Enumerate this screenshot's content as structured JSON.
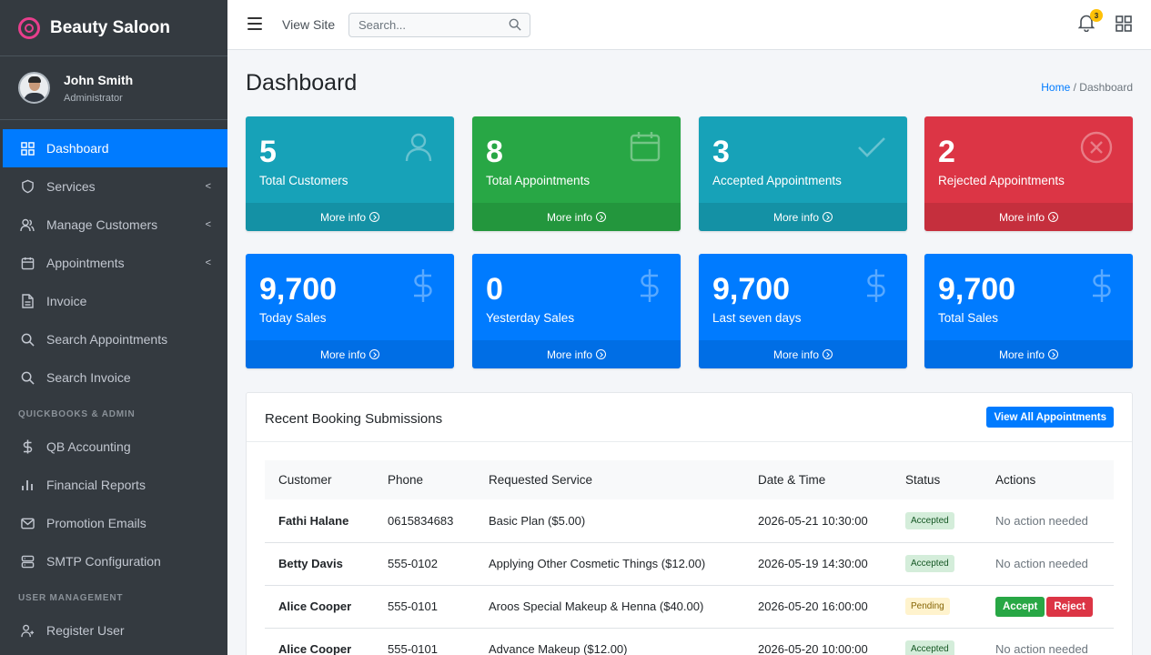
{
  "brand": {
    "name": "Beauty Saloon"
  },
  "user": {
    "name": "John Smith",
    "role": "Administrator"
  },
  "sidebar": {
    "items": [
      {
        "label": "Dashboard"
      },
      {
        "label": "Services",
        "caret": "<"
      },
      {
        "label": "Manage Customers",
        "caret": "<"
      },
      {
        "label": "Appointments",
        "caret": "<"
      },
      {
        "label": "Invoice"
      },
      {
        "label": "Search Appointments"
      },
      {
        "label": "Search Invoice"
      }
    ],
    "header_qb": "QUICKBOOKS & ADMIN",
    "qb_items": [
      {
        "label": "QB Accounting"
      },
      {
        "label": "Financial Reports"
      },
      {
        "label": "Promotion Emails"
      },
      {
        "label": "SMTP Configuration"
      }
    ],
    "header_user": "USER MANAGEMENT",
    "user_items": [
      {
        "label": "Register User"
      }
    ]
  },
  "topbar": {
    "view_site": "View Site",
    "search_placeholder": "Search...",
    "notification_count": "3"
  },
  "page": {
    "title": "Dashboard",
    "breadcrumb_home": "Home",
    "breadcrumb_sep": " / ",
    "breadcrumb_current": "Dashboard"
  },
  "boxes": [
    {
      "value": "5",
      "label": "Total Customers",
      "more": "More info",
      "icon": "user-icon",
      "color": "#17a2b8"
    },
    {
      "value": "8",
      "label": "Total Appointments",
      "more": "More info",
      "icon": "calendar-icon",
      "color": "#28a745"
    },
    {
      "value": "3",
      "label": "Accepted Appointments",
      "more": "More info",
      "icon": "check-icon",
      "color": "#17a2b8"
    },
    {
      "value": "2",
      "label": "Rejected Appointments",
      "more": "More info",
      "icon": "times-circle-icon",
      "color": "#dc3545"
    },
    {
      "value": "9,700",
      "label": "Today Sales",
      "more": "More info",
      "icon": "dollar-icon",
      "color": "#007bff"
    },
    {
      "value": "0",
      "label": "Yesterday Sales",
      "more": "More info",
      "icon": "dollar-icon",
      "color": "#007bff"
    },
    {
      "value": "9,700",
      "label": "Last seven days",
      "more": "More info",
      "icon": "dollar-icon",
      "color": "#007bff"
    },
    {
      "value": "9,700",
      "label": "Total Sales",
      "more": "More info",
      "icon": "dollar-icon",
      "color": "#007bff"
    }
  ],
  "bookings": {
    "title": "Recent Booking Submissions",
    "view_all": "View All Appointments",
    "columns": [
      "Customer",
      "Phone",
      "Requested Service",
      "Date & Time",
      "Status",
      "Actions"
    ],
    "rows": [
      {
        "customer": "Fathi Halane",
        "phone": "0615834683",
        "service": "Basic Plan ($5.00)",
        "datetime": "2026-05-21 10:30:00",
        "status": "Accepted",
        "action": "No action needed"
      },
      {
        "customer": "Betty Davis",
        "phone": "555-0102",
        "service": "Applying Other Cosmetic Things ($12.00)",
        "datetime": "2026-05-19 14:30:00",
        "status": "Accepted",
        "action": "No action needed"
      },
      {
        "customer": "Alice Cooper",
        "phone": "555-0101",
        "service": "Aroos Special Makeup & Henna ($40.00)",
        "datetime": "2026-05-20 16:00:00",
        "status": "Pending",
        "accept": "Accept",
        "reject": "Reject"
      },
      {
        "customer": "Alice Cooper",
        "phone": "555-0101",
        "service": "Advance Makeup ($12.00)",
        "datetime": "2026-05-20 10:00:00",
        "status": "Accepted",
        "action": "No action needed"
      }
    ]
  }
}
